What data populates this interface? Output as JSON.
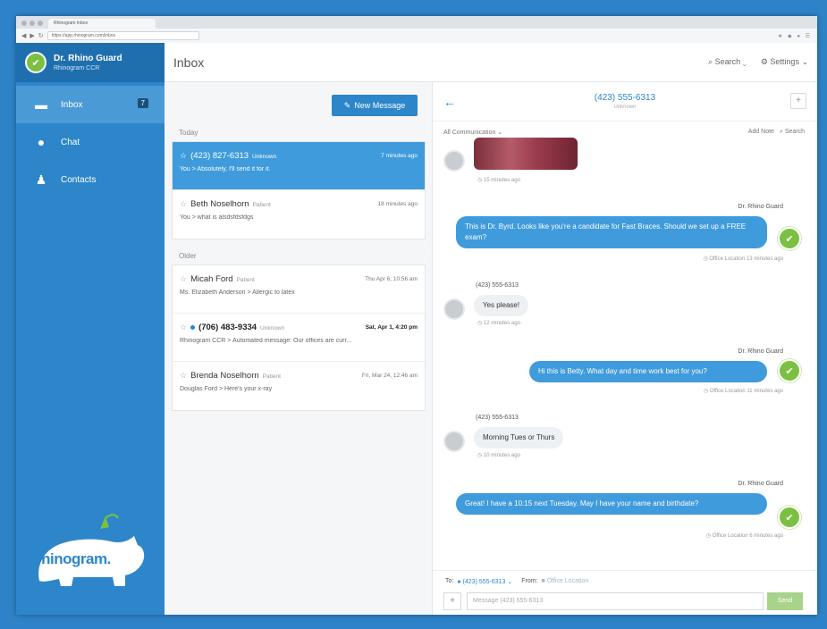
{
  "browser": {
    "tab_title": "Rhinogram Inbox",
    "url": "https://app.rhinogram.com/inbox"
  },
  "profile": {
    "name": "Dr. Rhino Guard",
    "org": "Rhinogram CCR"
  },
  "nav": [
    {
      "label": "Inbox",
      "icon": "inbox-icon",
      "badge": "7",
      "active": true
    },
    {
      "label": "Chat",
      "icon": "chat-bubble-icon"
    },
    {
      "label": "Contacts",
      "icon": "person-icon"
    }
  ],
  "logo_text": "rhinogram.",
  "topbar": {
    "title": "Inbox",
    "search": "Search",
    "settings": "Settings"
  },
  "list": {
    "new_message": "New Message",
    "today_label": "Today",
    "older_label": "Older",
    "today": [
      {
        "name": "(423) 827-6313",
        "role": "Unknown",
        "time": "7 minutes ago",
        "preview": "You > Absolutely, I'll send it for it.",
        "selected": true
      },
      {
        "name": "Beth Noselhorn",
        "role": "Patient",
        "time": "18 minutes ago",
        "preview": "You > what is alsdsfdsfdgs"
      }
    ],
    "older": [
      {
        "name": "Micah Ford",
        "role": "Patient",
        "time": "Thu Apr 6, 10:56 am",
        "preview": "Ms. Elizabeth Anderson > Allergic to latex"
      },
      {
        "name": "(706) 483-9334",
        "role": "Unknown",
        "time": "Sat, Apr 1, 4:20 pm",
        "preview": "Rhinogram CCR > Automated message: Our offices are curr...",
        "unread": true
      },
      {
        "name": "Brenda Noselhorn",
        "role": "Patient",
        "time": "Fri, Mar 24, 12:46 am",
        "preview": "Douglas Ford > Here's your x-ray"
      }
    ]
  },
  "conversation": {
    "phone": "(423) 555-6313",
    "subtitle": "Unknown",
    "filter": "All Communication",
    "add_note": "Add Note",
    "search": "Search",
    "messages": [
      {
        "dir": "in",
        "kind": "image",
        "meta": "15 minutes ago"
      },
      {
        "dir": "out",
        "sender": "Dr. Rhino Guard",
        "text": "This is Dr. Byrd. Looks like you're a candidate for Fast Braces. Should we set up a FREE exam?",
        "meta": "Office Location 13 minutes ago"
      },
      {
        "dir": "in",
        "sender": "(423) 555-6313",
        "text": "Yes please!",
        "meta": "12 minutes ago"
      },
      {
        "dir": "out",
        "sender": "Dr. Rhino Guard",
        "text": "Hi this is Betty. What day and time work best for you?",
        "meta": "Office Location 11 minutes ago"
      },
      {
        "dir": "in",
        "sender": "(423) 555-6313",
        "text": "Morning Tues or Thurs",
        "meta": "10 minutes ago"
      },
      {
        "dir": "out",
        "sender": "Dr. Rhino Guard",
        "text": "Great! I have a 10:15 next Tuesday. May I have your name and birthdate?",
        "meta": "Office Location 6 minutes ago"
      }
    ],
    "compose": {
      "to_label": "To:",
      "to_value": "(423) 555-6313",
      "from_label": "From:",
      "from_value": "Office Location",
      "placeholder": "Message (423) 555-6313",
      "send": "Send"
    }
  }
}
